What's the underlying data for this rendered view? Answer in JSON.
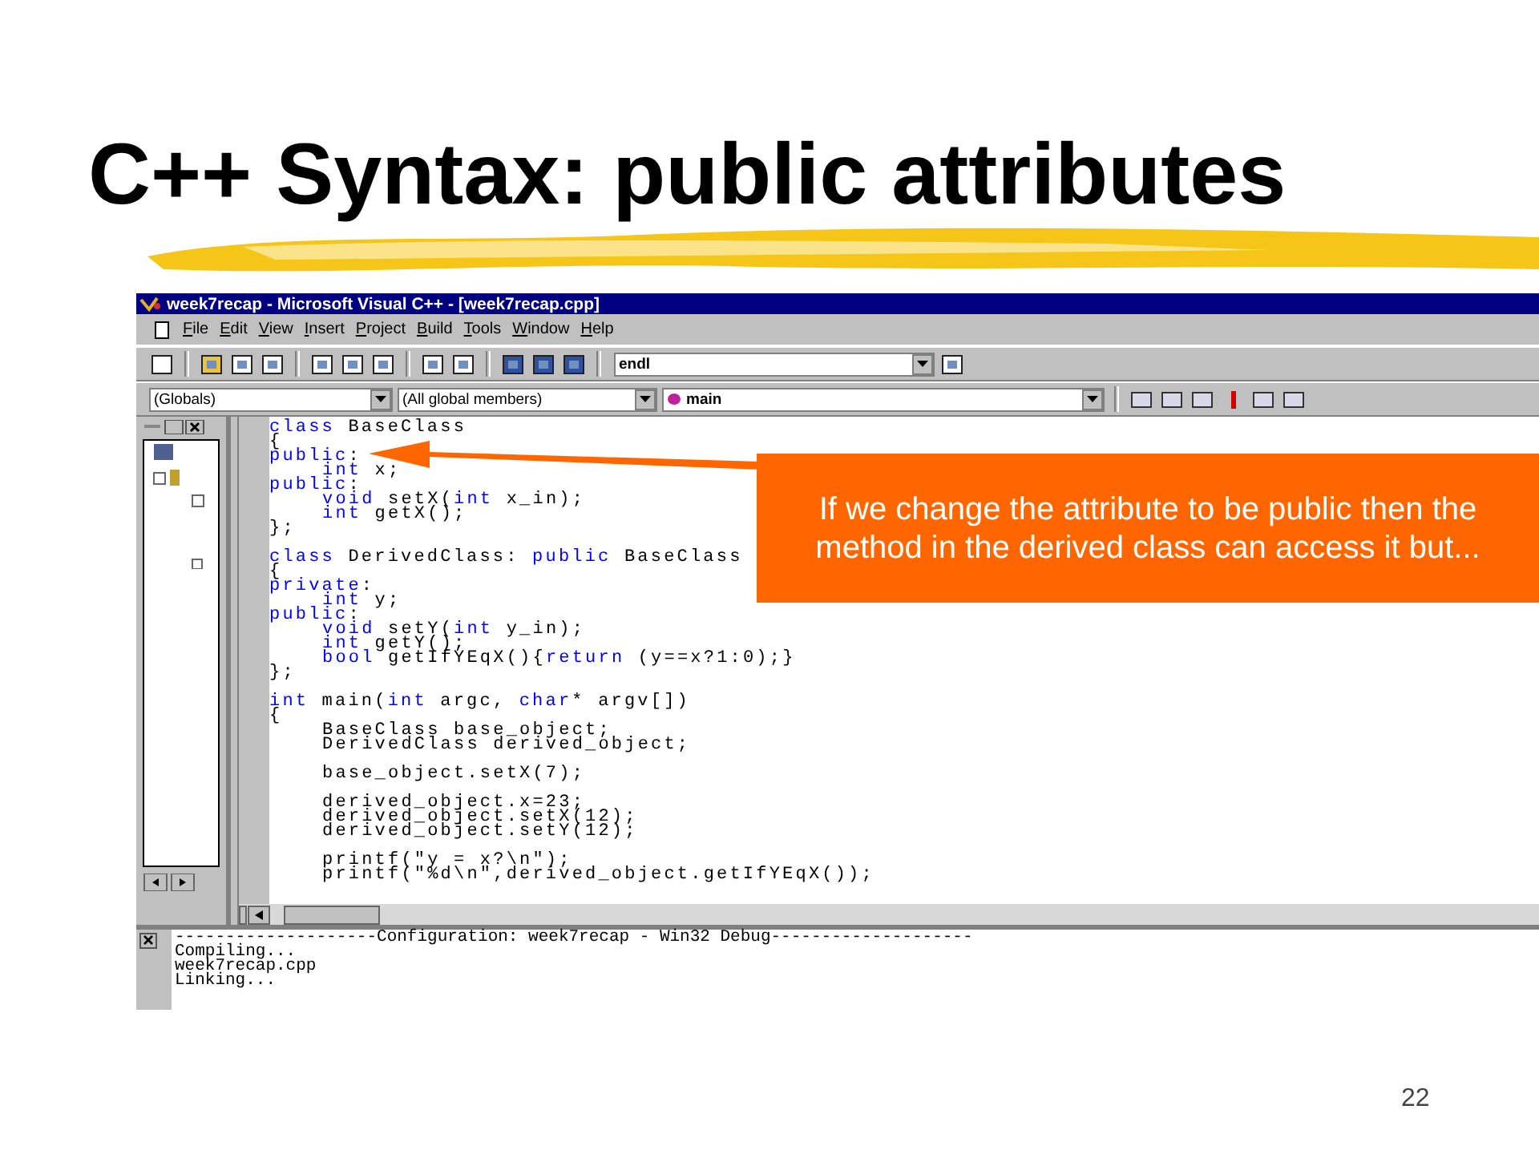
{
  "slide": {
    "title": "C++ Syntax: public attributes",
    "page_number": "22"
  },
  "window": {
    "title": "week7recap - Microsoft Visual C++ - [week7recap.cpp]"
  },
  "menu": [
    "File",
    "Edit",
    "View",
    "Insert",
    "Project",
    "Build",
    "Tools",
    "Window",
    "Help"
  ],
  "toolbar": {
    "find_combo": "endl"
  },
  "wizard_bar": {
    "class_combo": "(Globals)",
    "members_combo": "(All global members)",
    "function_combo": "main"
  },
  "editor": {
    "lines": [
      {
        "gap_before": false,
        "indented": false,
        "segments": [
          {
            "text": "class",
            "keyword": true
          },
          {
            "text": " BaseClass",
            "keyword": false
          }
        ]
      },
      {
        "gap_before": false,
        "indented": false,
        "segments": [
          {
            "text": "{",
            "keyword": false
          }
        ]
      },
      {
        "gap_before": false,
        "indented": false,
        "segments": [
          {
            "text": "public",
            "keyword": true
          },
          {
            "text": ":",
            "keyword": false
          }
        ]
      },
      {
        "gap_before": false,
        "indented": true,
        "segments": [
          {
            "text": "int",
            "keyword": true
          },
          {
            "text": " x;",
            "keyword": false
          }
        ]
      },
      {
        "gap_before": false,
        "indented": false,
        "segments": [
          {
            "text": "public",
            "keyword": true
          },
          {
            "text": ":",
            "keyword": false
          }
        ]
      },
      {
        "gap_before": false,
        "indented": true,
        "segments": [
          {
            "text": "void",
            "keyword": true
          },
          {
            "text": " setX(",
            "keyword": false
          },
          {
            "text": "int",
            "keyword": true
          },
          {
            "text": " x_in);",
            "keyword": false
          }
        ]
      },
      {
        "gap_before": false,
        "indented": true,
        "segments": [
          {
            "text": "int",
            "keyword": true
          },
          {
            "text": " getX();",
            "keyword": false
          }
        ]
      },
      {
        "gap_before": false,
        "indented": false,
        "segments": [
          {
            "text": "};",
            "keyword": false
          }
        ]
      },
      {
        "gap_before": true,
        "indented": false,
        "segments": [
          {
            "text": "class",
            "keyword": true
          },
          {
            "text": " DerivedClass: ",
            "keyword": false
          },
          {
            "text": "public",
            "keyword": true
          },
          {
            "text": " BaseClass",
            "keyword": false
          }
        ]
      },
      {
        "gap_before": false,
        "indented": false,
        "segments": [
          {
            "text": "{",
            "keyword": false
          }
        ]
      },
      {
        "gap_before": false,
        "indented": false,
        "segments": [
          {
            "text": "private",
            "keyword": true
          },
          {
            "text": ":",
            "keyword": false
          }
        ]
      },
      {
        "gap_before": false,
        "indented": true,
        "segments": [
          {
            "text": "int",
            "keyword": true
          },
          {
            "text": " y;",
            "keyword": false
          }
        ]
      },
      {
        "gap_before": false,
        "indented": false,
        "segments": [
          {
            "text": "public",
            "keyword": true
          },
          {
            "text": ":",
            "keyword": false
          }
        ]
      },
      {
        "gap_before": false,
        "indented": true,
        "segments": [
          {
            "text": "void",
            "keyword": true
          },
          {
            "text": " setY(",
            "keyword": false
          },
          {
            "text": "int",
            "keyword": true
          },
          {
            "text": " y_in);",
            "keyword": false
          }
        ]
      },
      {
        "gap_before": false,
        "indented": true,
        "segments": [
          {
            "text": "int",
            "keyword": true
          },
          {
            "text": " getY();",
            "keyword": false
          }
        ]
      },
      {
        "gap_before": false,
        "indented": true,
        "segments": [
          {
            "text": "bool",
            "keyword": true
          },
          {
            "text": " getIfYEqX(){",
            "keyword": false
          },
          {
            "text": "return",
            "keyword": true
          },
          {
            "text": " (y==x?1:0);}",
            "keyword": false
          }
        ]
      },
      {
        "gap_before": false,
        "indented": false,
        "segments": [
          {
            "text": "};",
            "keyword": false
          }
        ]
      },
      {
        "gap_before": true,
        "indented": false,
        "segments": [
          {
            "text": "int",
            "keyword": true
          },
          {
            "text": " main(",
            "keyword": false
          },
          {
            "text": "int",
            "keyword": true
          },
          {
            "text": " argc, ",
            "keyword": false
          },
          {
            "text": "char",
            "keyword": true
          },
          {
            "text": "* argv[])",
            "keyword": false
          }
        ]
      },
      {
        "gap_before": false,
        "indented": false,
        "segments": [
          {
            "text": "{",
            "keyword": false
          }
        ]
      },
      {
        "gap_before": false,
        "indented": true,
        "segments": [
          {
            "text": "BaseClass base_object;",
            "keyword": false
          }
        ]
      },
      {
        "gap_before": false,
        "indented": true,
        "segments": [
          {
            "text": "DerivedClass derived_object;",
            "keyword": false
          }
        ]
      },
      {
        "gap_before": true,
        "indented": true,
        "segments": [
          {
            "text": "base_object.setX(7);",
            "keyword": false
          }
        ]
      },
      {
        "gap_before": true,
        "indented": true,
        "segments": [
          {
            "text": "derived_object.x=23;",
            "keyword": false
          }
        ]
      },
      {
        "gap_before": false,
        "indented": true,
        "segments": [
          {
            "text": "derived_object.setX(12);",
            "keyword": false
          }
        ]
      },
      {
        "gap_before": false,
        "indented": true,
        "segments": [
          {
            "text": "derived_object.setY(12);",
            "keyword": false
          }
        ]
      },
      {
        "gap_before": true,
        "indented": true,
        "segments": [
          {
            "text": "printf(\"y = x?\\n\");",
            "keyword": false
          }
        ]
      },
      {
        "gap_before": false,
        "indented": true,
        "segments": [
          {
            "text": "printf(\"%d\\n\",derived_object.getIfYEqX());",
            "keyword": false
          }
        ]
      }
    ]
  },
  "output": {
    "lines": [
      "--------------------Configuration: week7recap - Win32 Debug--------------------",
      "Compiling...",
      "week7recap.cpp",
      "Linking..."
    ]
  },
  "callout": {
    "text": "If we change the attribute to be public then the method in the derived class can access it but..."
  }
}
